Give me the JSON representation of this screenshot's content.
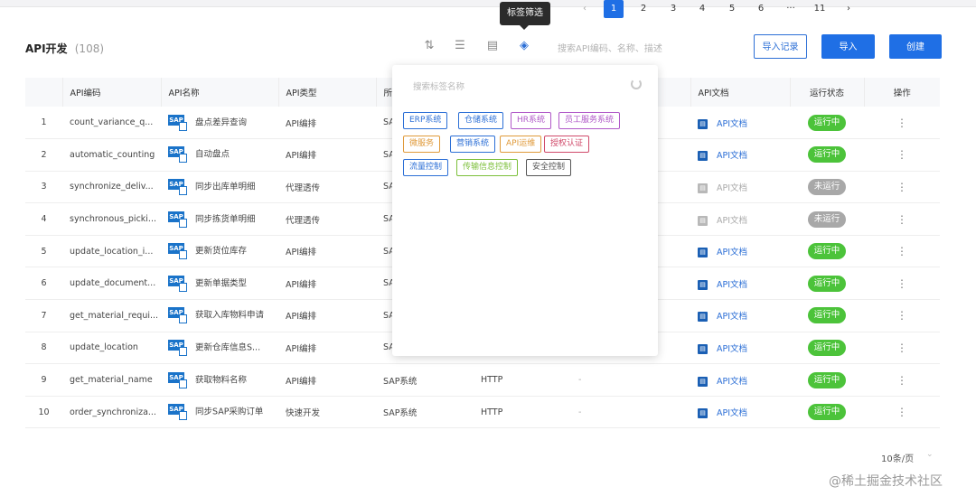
{
  "header": {
    "title": "API开发",
    "count": "(108)",
    "search_placeholder": "搜索API编码、名称、描述",
    "import_log_label": "导入记录",
    "import_label": "导入",
    "create_label": "创建",
    "tooltip": "标签筛选"
  },
  "table": {
    "columns": [
      "API编码",
      "API名称",
      "API类型",
      "所",
      "API文档",
      "运行状态",
      "操作"
    ],
    "rows": [
      {
        "idx": "1",
        "code": "count_variance_q...",
        "name": "盘点差异查询",
        "type": "API编排",
        "sys": "SAP",
        "proto": "",
        "desc": "",
        "doc": "API文档",
        "status": "运行中",
        "running": true
      },
      {
        "idx": "2",
        "code": "automatic_counting",
        "name": "自动盘点",
        "type": "API编排",
        "sys": "SAP",
        "proto": "",
        "desc": "",
        "doc": "API文档",
        "status": "运行中",
        "running": true
      },
      {
        "idx": "3",
        "code": "synchronize_deliv...",
        "name": "同步出库单明细",
        "type": "代理透传",
        "sys": "SAP",
        "proto": "",
        "desc": "",
        "doc": "API文档",
        "status": "未运行",
        "running": false
      },
      {
        "idx": "4",
        "code": "synchronous_picki...",
        "name": "同步拣货单明细",
        "type": "代理透传",
        "sys": "SAP",
        "proto": "",
        "desc": "",
        "doc": "API文档",
        "status": "未运行",
        "running": false
      },
      {
        "idx": "5",
        "code": "update_location_i...",
        "name": "更新货位库存",
        "type": "API编排",
        "sys": "SAP",
        "proto": "",
        "desc": "",
        "doc": "API文档",
        "status": "运行中",
        "running": true
      },
      {
        "idx": "6",
        "code": "update_document...",
        "name": "更新单据类型",
        "type": "API编排",
        "sys": "SAP",
        "proto": "",
        "desc": "",
        "doc": "API文档",
        "status": "运行中",
        "running": true
      },
      {
        "idx": "7",
        "code": "get_material_requi...",
        "name": "获取入库物料申请",
        "type": "API编排",
        "sys": "SAP",
        "proto": "",
        "desc": "",
        "doc": "API文档",
        "status": "运行中",
        "running": true
      },
      {
        "idx": "8",
        "code": "update_location",
        "name": "更新仓库信息S...",
        "type": "API编排",
        "sys": "SAP",
        "proto": "",
        "desc": "",
        "doc": "API文档",
        "status": "运行中",
        "running": true
      },
      {
        "idx": "9",
        "code": "get_material_name",
        "name": "获取物料名称",
        "type": "API编排",
        "sys": "SAP系统",
        "proto": "HTTP",
        "desc": "-",
        "doc": "API文档",
        "status": "运行中",
        "running": true
      },
      {
        "idx": "10",
        "code": "order_synchroniza...",
        "name": "同步SAP采购订单",
        "type": "快速开发",
        "sys": "SAP系统",
        "proto": "HTTP",
        "desc": "-",
        "doc": "API文档",
        "status": "运行中",
        "running": true
      }
    ]
  },
  "tag_panel": {
    "search_placeholder": "搜索标签名称",
    "tags": [
      {
        "label": "ERP系统",
        "color": "#2c6fd6"
      },
      {
        "label": "仓储系统",
        "color": "#2c6fd6"
      },
      {
        "label": "HR系统",
        "color": "#b058c8"
      },
      {
        "label": "员工服务系统",
        "color": "#b058c8"
      },
      {
        "label": "微服务",
        "color": "#e09a3a"
      },
      {
        "label": "营销系统",
        "color": "#2c6fd6"
      },
      {
        "label": "API运维",
        "color": "#e09a3a"
      },
      {
        "label": "授权认证",
        "color": "#d04a6a"
      },
      {
        "label": "流量控制",
        "color": "#2c6fd6"
      },
      {
        "label": "传输信息控制",
        "color": "#7cbf3a"
      },
      {
        "label": "安全控制",
        "color": "#555555"
      }
    ]
  },
  "pagination": {
    "pages": [
      "1",
      "2",
      "3",
      "4",
      "5",
      "6",
      "···",
      "11"
    ],
    "active": "1",
    "page_size": "10条/页"
  },
  "watermark": "@稀土掘金技术社区"
}
